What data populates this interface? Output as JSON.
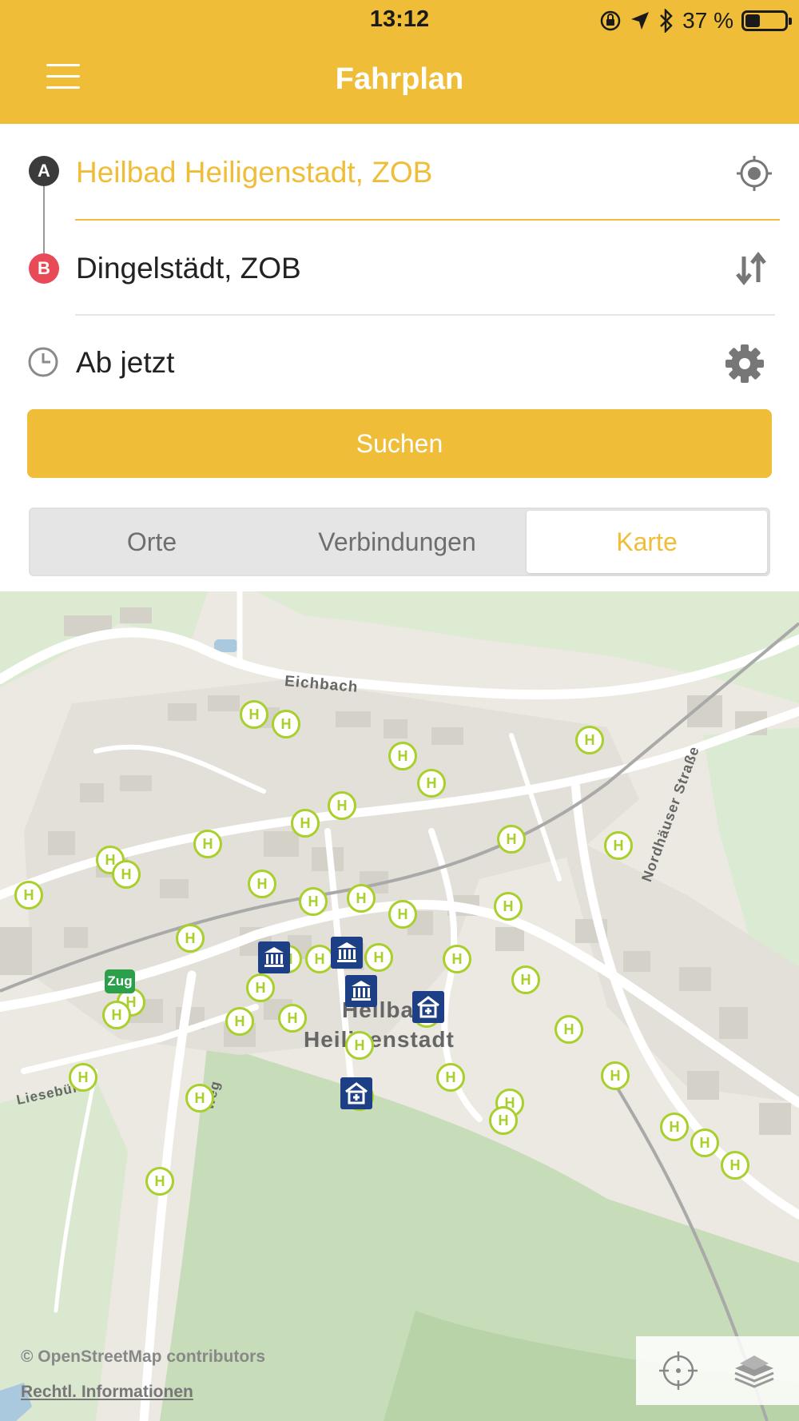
{
  "status_bar": {
    "time": "13:12",
    "battery": "37 %",
    "battery_level": 0.37
  },
  "header": {
    "title": "Fahrplan",
    "menu_icon": "hamburger-icon"
  },
  "form": {
    "from": "Heilbad Heiligenstadt, ZOB",
    "to": "Dingelstädt, ZOB",
    "from_marker": "A",
    "to_marker": "B",
    "time": "Ab jetzt",
    "search_label": "Suchen"
  },
  "tabs": {
    "items": [
      "Orte",
      "Verbindungen",
      "Karte"
    ],
    "selected": "Karte"
  },
  "map": {
    "stop_symbol": "H",
    "train_label": "Zug",
    "town_label_1": "Heilbad",
    "town_label_2": "Heiligenstadt",
    "street_eichbach": "Eichbach",
    "street_nordhaeuser": "Nordhäuser Straße",
    "street_liesebuhl": "Liesebühl",
    "street_weg": "weg",
    "copyright": "© OpenStreetMap contributors",
    "legal": "Rechtl. Informationen"
  },
  "colors": {
    "accent": "#F0BD38",
    "marker_b": "#e84a57",
    "stop": "#a8cf2a",
    "poi": "#1d3f86",
    "train": "#2aa04a"
  }
}
